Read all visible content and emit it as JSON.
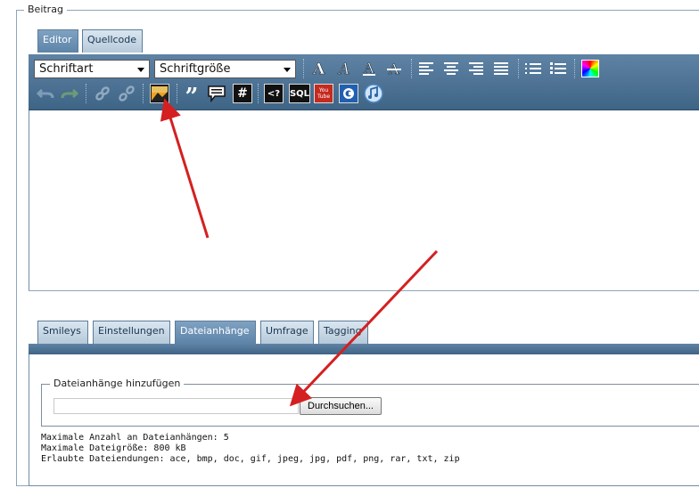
{
  "fieldset": {
    "legend": "Beitrag"
  },
  "editor_tabs": [
    {
      "label": "Editor",
      "active": true
    },
    {
      "label": "Quellcode",
      "active": false
    }
  ],
  "toolbar": {
    "font_family": "Schriftart",
    "font_size": "Schriftgröße",
    "sql_label": "SQL",
    "code_label": "<?",
    "hash_label": "#",
    "quote_label": "”",
    "youtube_label": "You Tube",
    "icons": [
      "bold-a-icon",
      "italic-a-icon",
      "underline-a-icon",
      "strikethrough-a-icon",
      "align-left-icon",
      "align-center-icon",
      "align-right-icon",
      "align-justify-icon",
      "unordered-list-icon",
      "ordered-list-icon",
      "color-picker-icon",
      "undo-icon",
      "redo-icon",
      "link-icon",
      "unlink-icon",
      "insert-image-icon",
      "quote-icon",
      "speech-bubble-icon",
      "hash-icon",
      "php-code-icon",
      "sql-icon",
      "youtube-icon",
      "copyright-icon",
      "music-icon"
    ]
  },
  "bottom_tabs": [
    {
      "label": "Smileys",
      "active": false
    },
    {
      "label": "Einstellungen",
      "active": false
    },
    {
      "label": "Dateianhänge",
      "active": true
    },
    {
      "label": "Umfrage",
      "active": false
    },
    {
      "label": "Tagging",
      "active": false
    }
  ],
  "attachments": {
    "legend": "Dateianhänge hinzufügen",
    "file_value": "",
    "browse_label": "Durchsuchen...",
    "max_count": "Maximale Anzahl an Dateianhängen: 5",
    "max_size": "Maximale Dateigröße: 800 kB",
    "extensions": "Erlaubte Dateiendungen: ace, bmp, doc, gif, jpeg, jpg, pdf, png, rar, txt, zip"
  },
  "colors": {
    "toolbar": "#4a6f92",
    "annotation_arrow": "#d42020",
    "tab_active": "#6f94b7"
  }
}
